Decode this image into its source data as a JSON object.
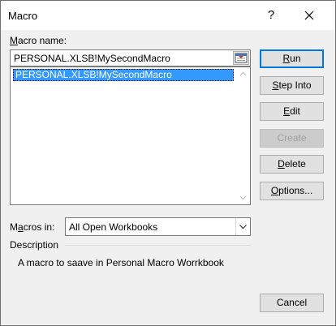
{
  "window": {
    "title": "Macro",
    "help_label": "?"
  },
  "macro_name": {
    "label_prefix": "",
    "label_accel": "M",
    "label_rest": "acro name:",
    "value": "PERSONAL.XLSB!MySecondMacro"
  },
  "macro_list": {
    "items": [
      "PERSONAL.XLSB!MySecondMacro"
    ],
    "selected_index": 0
  },
  "buttons": {
    "run": {
      "accel": "R",
      "rest": "un"
    },
    "step_into": {
      "accel": "S",
      "rest": "tep Into"
    },
    "edit": {
      "accel": "E",
      "rest": "dit"
    },
    "create": {
      "label": "Create",
      "enabled": false
    },
    "delete": {
      "accel": "D",
      "rest": "elete"
    },
    "options": {
      "accel": "O",
      "rest": "ptions..."
    },
    "cancel": "Cancel"
  },
  "macros_in": {
    "label_prefix": "M",
    "label_accel": "a",
    "label_rest": "cros in:",
    "value": "All Open Workbooks"
  },
  "description": {
    "label": "Description",
    "text": "A macro to saave in Personal Macro Worrkbook"
  },
  "colors": {
    "selection": "#3399ff",
    "focus_border": "#0078d7"
  }
}
